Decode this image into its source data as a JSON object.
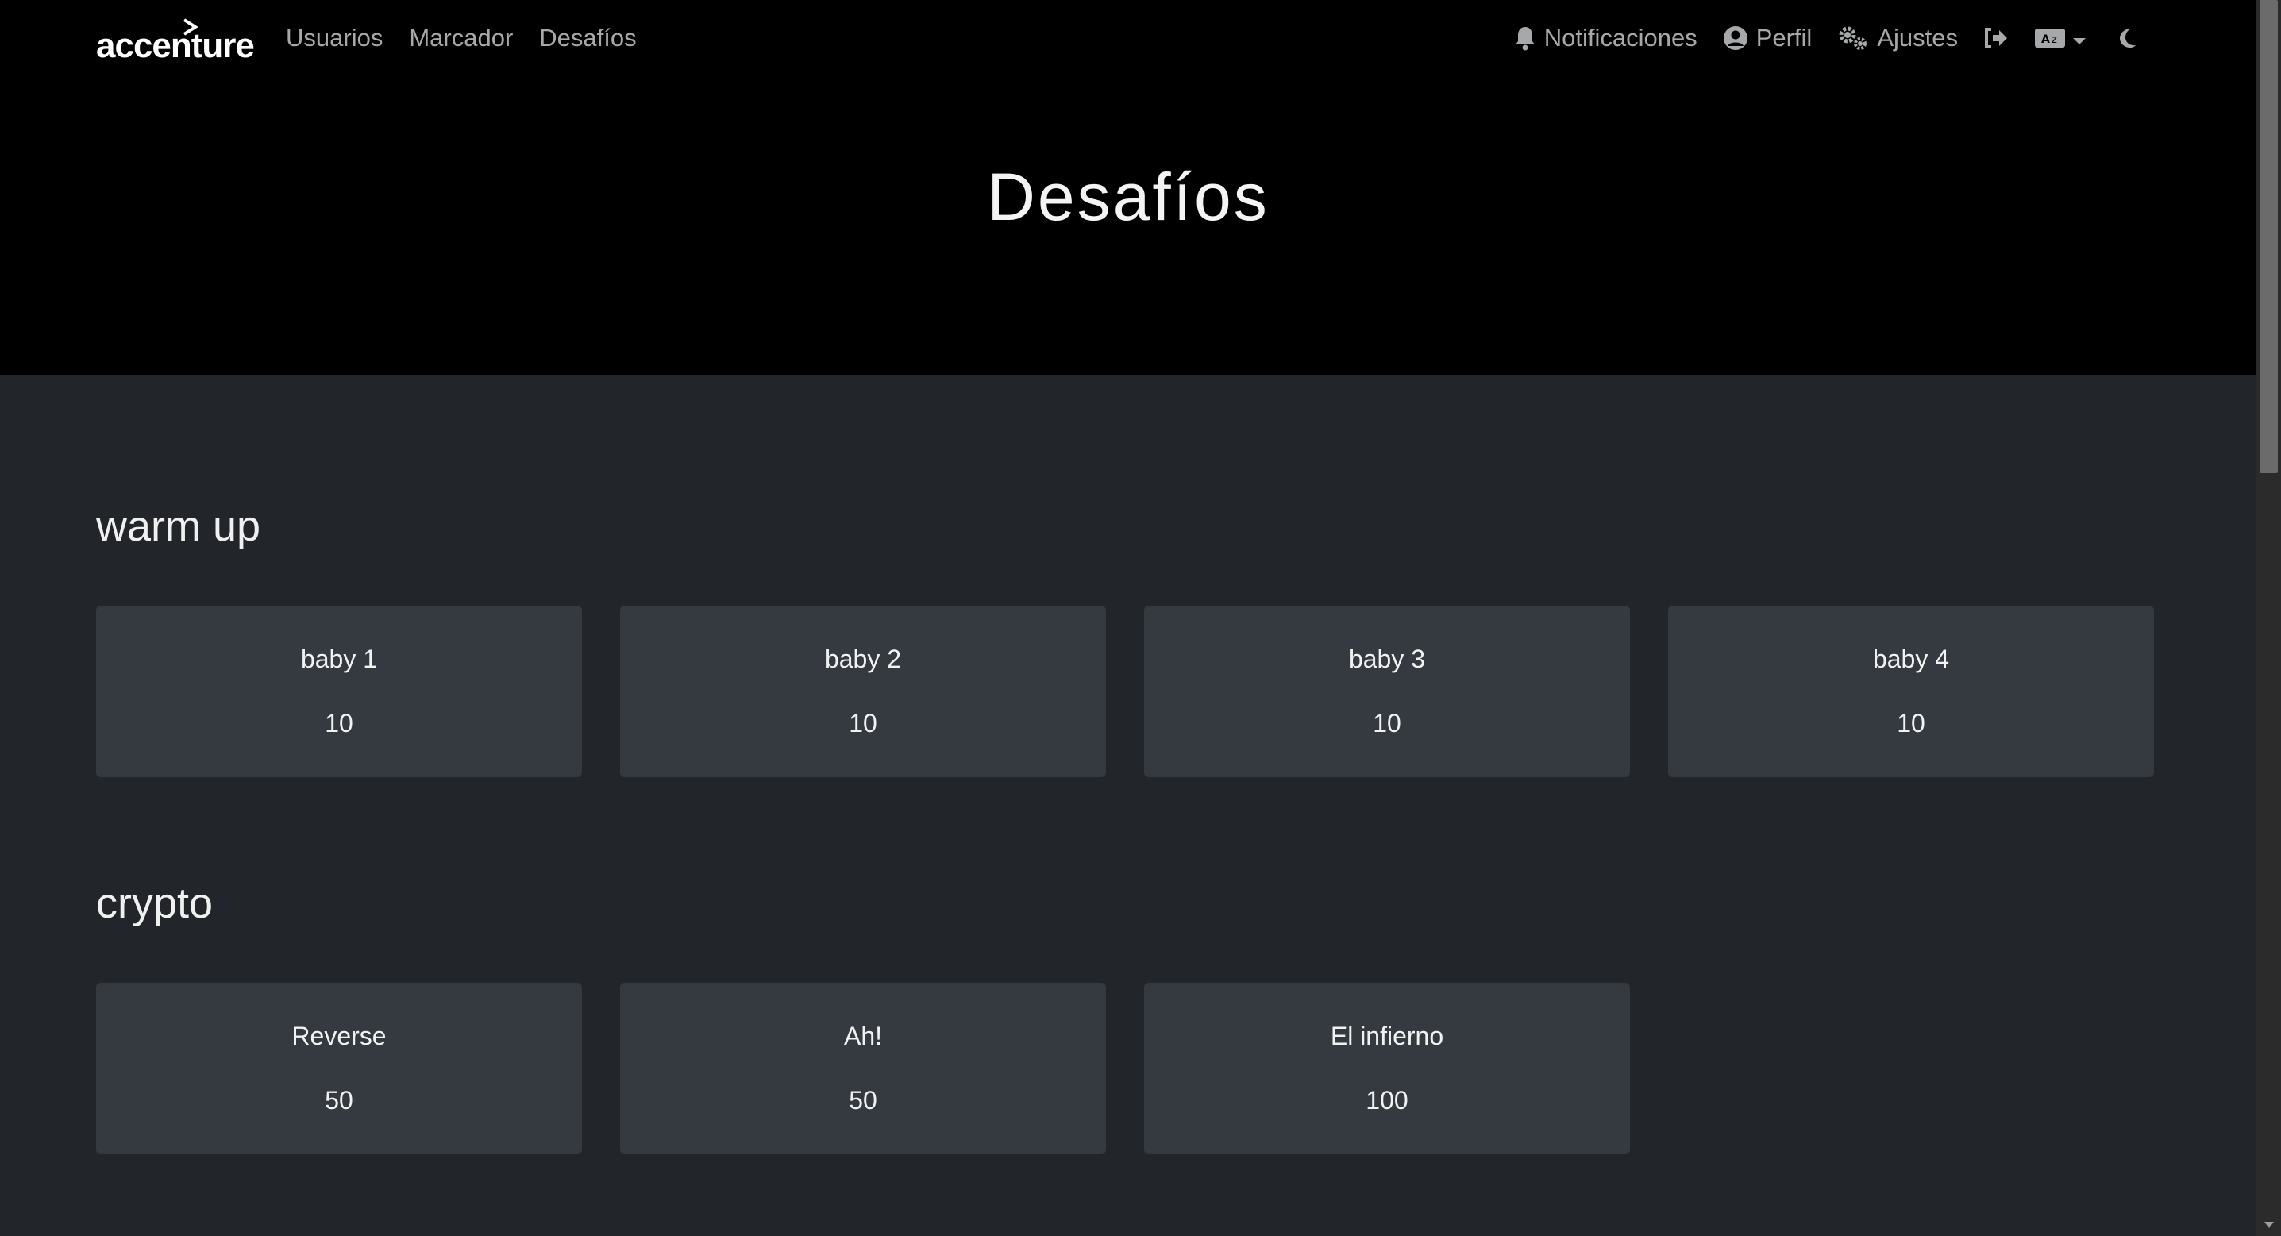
{
  "brand": {
    "name": "accenture"
  },
  "nav": {
    "left": [
      {
        "label": "Usuarios"
      },
      {
        "label": "Marcador"
      },
      {
        "label": "Desafíos"
      }
    ],
    "right": {
      "notifications": "Notificaciones",
      "profile": "Perfil",
      "settings": "Ajustes"
    }
  },
  "page": {
    "title": "Desafíos"
  },
  "categories": [
    {
      "name": "warm up",
      "challenges": [
        {
          "name": "baby 1",
          "value": "10"
        },
        {
          "name": "baby 2",
          "value": "10"
        },
        {
          "name": "baby 3",
          "value": "10"
        },
        {
          "name": "baby 4",
          "value": "10"
        }
      ]
    },
    {
      "name": "crypto",
      "challenges": [
        {
          "name": "Reverse",
          "value": "50"
        },
        {
          "name": "Ah!",
          "value": "50"
        },
        {
          "name": "El infierno",
          "value": "100"
        }
      ]
    }
  ],
  "icons": {
    "notifications": "bell-icon",
    "profile": "user-circle-icon",
    "settings": "cogs-icon",
    "logout": "sign-out-icon",
    "language": "language-icon",
    "theme": "moon-icon"
  },
  "colors": {
    "navbar_bg": "#000000",
    "body_bg": "#222529",
    "card_bg": "#343a40",
    "nav_text": "#a6a8aa"
  }
}
